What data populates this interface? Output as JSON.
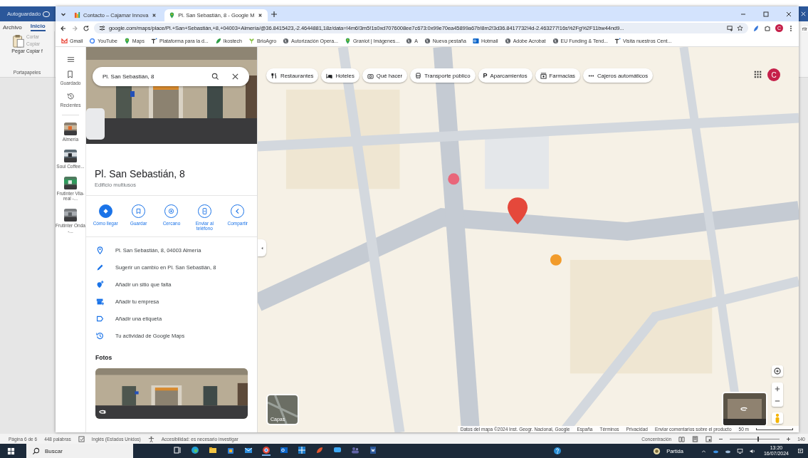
{
  "word": {
    "title": "Autoguardado",
    "menu": [
      {
        "label": "Archivo",
        "selected": false
      },
      {
        "label": "Inicio",
        "selected": true
      }
    ],
    "clipboard": {
      "paste": "Pegar",
      "cut": "Cortar",
      "copy": "Copiar",
      "format": "Copiar f",
      "group": "Portapapeles"
    },
    "share_button": "rtir",
    "status_bar": {
      "page": "Página 6 de 6",
      "words": "448 palabras",
      "language": "Inglés (Estados Unidos)",
      "accessibility": "Accesibilidad: es necesario investigar",
      "focus": "Concentración",
      "zoom_slider": {
        "level": 0.55
      },
      "zoom": "140"
    }
  },
  "browser": {
    "tabs": [
      {
        "title": "Contacto – Cajamar Innova",
        "selected": false
      },
      {
        "title": "Pl. San Sebastián, 8 - Google M",
        "selected": true
      }
    ],
    "address": "google.com/maps/place/Pl.+San+Sebastián,+8,+04003+Almería/@36.8415423,-2.4644881,18z/data=!4m6!3m5!1s0xd7076008ee7c673:0x99e70ea45899a67b!8m2!3d36.8417732!4d-2.463277!16s%2Fg%2F11bw44nd9...",
    "profile": "C",
    "bookmarks": [
      "Gmail",
      "YouTube",
      "Maps",
      "Plataforma para la d...",
      "Ikostech",
      "BrioAgro",
      "Autorización Opera...",
      "Graniot | Imágenes...",
      "A",
      "Nueva pestaña",
      "Hotmail",
      "Adobe Acrobat",
      "EU Funding & Tend...",
      "Visita nuestros Cent..."
    ]
  },
  "maps": {
    "search": {
      "value": "Pl. San Sebastián, 8"
    },
    "rail": {
      "saved": "Guardado",
      "recent": "Recientes",
      "recents": [
        {
          "label": "Almería"
        },
        {
          "label": "Soul Coffee..."
        },
        {
          "label": "Frutinter Vila-real -..."
        },
        {
          "label": "Frutinter Onda -..."
        }
      ]
    },
    "place": {
      "title": "Pl. San Sebastián, 8",
      "subtitle": "Edificio multiusos"
    },
    "actions": [
      {
        "label": "Cómo llegar",
        "selected": true
      },
      {
        "label": "Guardar",
        "selected": false
      },
      {
        "label": "Cercano",
        "selected": false
      },
      {
        "label": "Enviar al teléfono",
        "selected": false
      },
      {
        "label": "Compartir",
        "selected": false
      }
    ],
    "details": [
      "Pl. San Sebastián, 8, 04003 Almería",
      "Sugerir un cambio en Pl. San Sebastián, 8",
      "Añadir un sitio que falta",
      "Añadir tu empresa",
      "Añadir una etiqueta",
      "Tu actividad de Google Maps"
    ],
    "photos_heading": "Fotos",
    "chips": [
      {
        "label": "Restaurantes"
      },
      {
        "label": "Hoteles"
      },
      {
        "label": "Qué hacer"
      },
      {
        "label": "Transporte público"
      },
      {
        "label": "Aparcamientos",
        "glyph": "P"
      },
      {
        "label": "Farmacias"
      },
      {
        "label": "Cajeros automáticos"
      }
    ],
    "avatar": "C",
    "layers": "Capas",
    "footer": [
      "Datos del mapa ©2024 Inst. Geogr. Nacional, Google",
      "España",
      "Términos",
      "Privacidad",
      "Enviar comentarios sobre el producto",
      "50 m"
    ]
  },
  "taskbar": {
    "search_placeholder": "Buscar",
    "weather": "Partida",
    "time": "13:20",
    "date": "16/07/2024"
  }
}
